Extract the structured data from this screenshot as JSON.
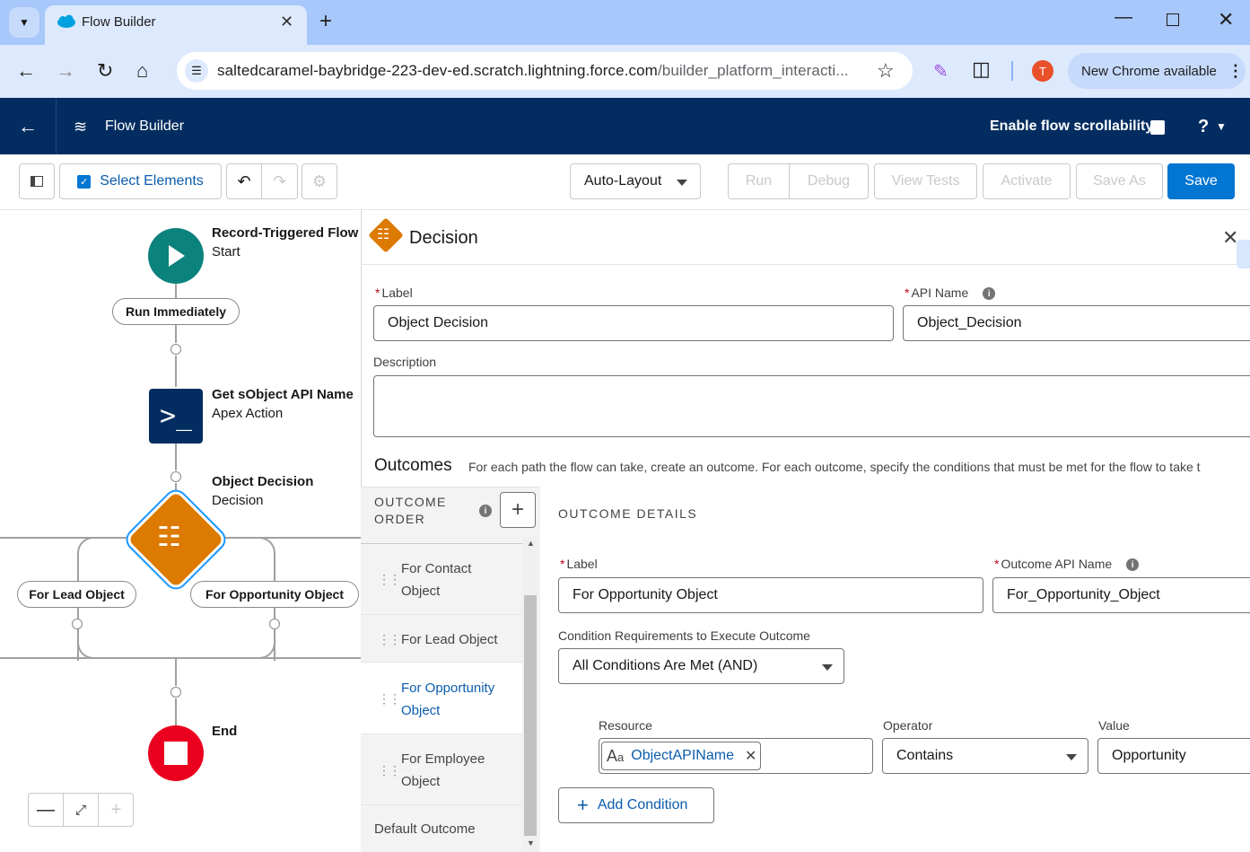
{
  "browser": {
    "tab_title": "Flow Builder",
    "url_host": "saltedcaramel-baybridge-223-dev-ed.scratch.lightning.force.com",
    "url_path": "/builder_platform_interacti...",
    "avatar_letter": "T",
    "update_label": "New Chrome available"
  },
  "app": {
    "title": "Flow Builder",
    "scroll_label": "Enable flow scrollability",
    "help_label": "?"
  },
  "toolbar": {
    "select_elements": "Select Elements",
    "layout": "Auto-Layout",
    "run": "Run",
    "debug": "Debug",
    "view_tests": "View Tests",
    "activate": "Activate",
    "save_as": "Save As",
    "save": "Save"
  },
  "canvas": {
    "start_title": "Record-Triggered Flow",
    "start_sub": "Start",
    "run_immediately": "Run Immediately",
    "apex_title": "Get sObject API Name",
    "apex_sub": "Apex Action",
    "decision_title": "Object Decision",
    "decision_sub": "Decision",
    "branch_left": "For Lead Object",
    "branch_right": "For Opportunity Object",
    "end_title": "End"
  },
  "panel": {
    "title": "Decision",
    "label_label": "Label",
    "label_value": "Object Decision",
    "api_label": "API Name",
    "api_value": "Object_Decision",
    "description_label": "Description",
    "outcomes_heading": "Outcomes",
    "outcomes_desc": "For each path the flow can take, create an outcome. For each outcome, specify the conditions that must be met for the flow to take t",
    "order_heading_1": "OUTCOME",
    "order_heading_2": "ORDER",
    "order_items": [
      {
        "l1": "For Contact",
        "l2": "Object"
      },
      {
        "l1": "For Lead Object",
        "l2": ""
      },
      {
        "l1": "For Opportunity",
        "l2": "Object"
      },
      {
        "l1": "For Employee",
        "l2": "Object"
      },
      {
        "l1": "Default Outcome",
        "l2": ""
      }
    ],
    "details_heading": "OUTCOME DETAILS",
    "outcome_label_label": "Label",
    "outcome_label_value": "For Opportunity Object",
    "outcome_api_label": "Outcome API Name",
    "outcome_api_value": "For_Opportunity_Object",
    "condition_req_label": "Condition Requirements to Execute Outcome",
    "condition_req_value": "All Conditions Are Met (AND)",
    "resource_label": "Resource",
    "resource_value": "ObjectAPIName",
    "operator_label": "Operator",
    "operator_value": "Contains",
    "value_label": "Value",
    "value_value": "Opportunity",
    "add_condition": "Add Condition"
  }
}
